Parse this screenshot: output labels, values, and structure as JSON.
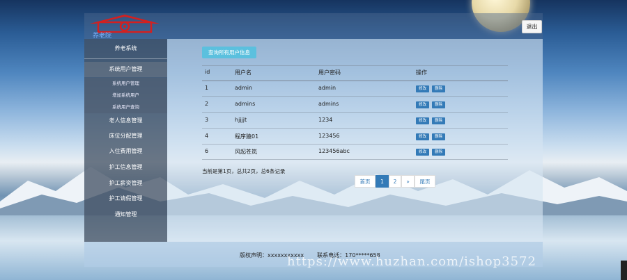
{
  "header": {
    "logo_text": "养老院",
    "logout_label": "退出"
  },
  "sidebar": {
    "title": "养老系统",
    "items": [
      {
        "label": "系统用户管理",
        "active": true,
        "children": [
          "系统用户管理",
          "增加系统用户",
          "系统用户查询"
        ]
      },
      {
        "label": "老人信息管理"
      },
      {
        "label": "床位分配管理"
      },
      {
        "label": "入住费用管理"
      },
      {
        "label": "护工信息管理"
      },
      {
        "label": "护工薪资管理"
      },
      {
        "label": "护工请假管理"
      },
      {
        "label": "通知管理"
      }
    ]
  },
  "main": {
    "query_button": "查询所有用户信息",
    "table": {
      "columns": [
        "id",
        "用户名",
        "用户密码",
        "操作"
      ],
      "rows": [
        {
          "id": "1",
          "username": "admin",
          "password": "admin"
        },
        {
          "id": "2",
          "username": "admins",
          "password": "admins"
        },
        {
          "id": "3",
          "username": "hjjjjt",
          "password": "1234"
        },
        {
          "id": "4",
          "username": "程序猿01",
          "password": "123456"
        },
        {
          "id": "6",
          "username": "风起苍岚",
          "password": "123456abc"
        }
      ],
      "edit_label": "修改",
      "delete_label": "删除"
    },
    "summary": "当前是第1页，总共2页，总6条记录",
    "pagination": {
      "first": "首页",
      "pages": [
        "1",
        "2"
      ],
      "current": "1",
      "next": "»",
      "last": "尾页"
    }
  },
  "footer": {
    "copyright": "版权声明：xxxxxxxxxxx",
    "phone": "联系电话：170*****658"
  },
  "watermark": "https://www.huzhan.com/ishop3572",
  "colors": {
    "primary": "#337ab7",
    "info": "#5bc0de"
  }
}
